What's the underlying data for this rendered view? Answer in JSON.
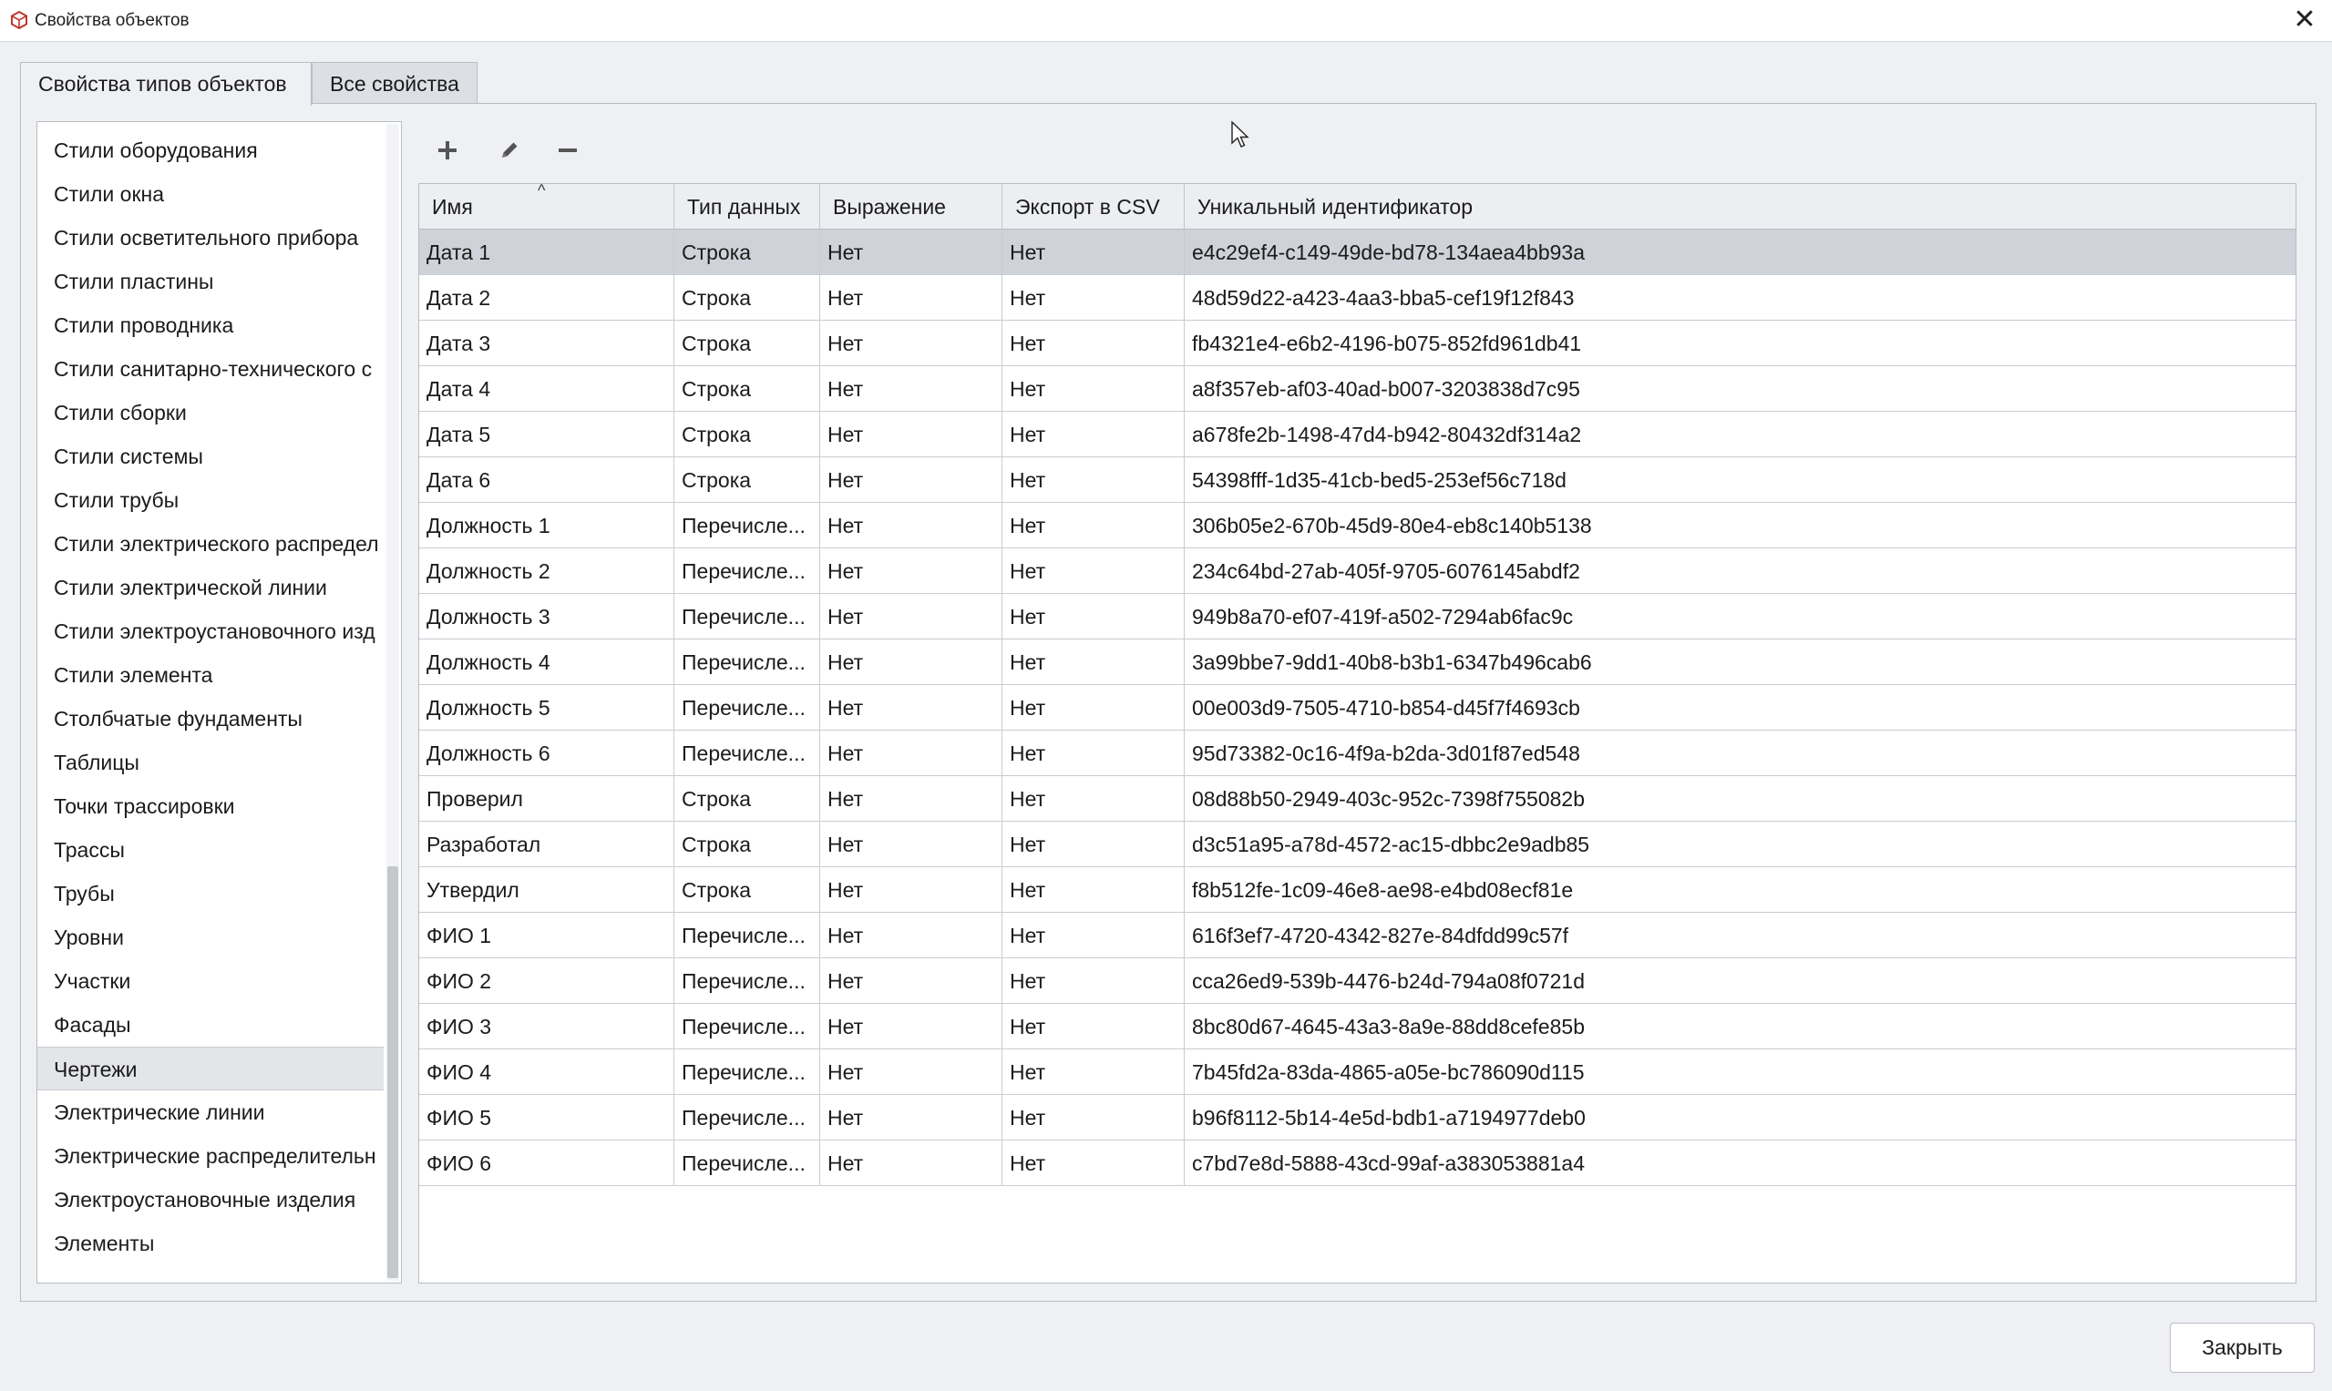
{
  "window": {
    "title": "Свойства объектов",
    "close_glyph": "✕"
  },
  "tabs": [
    {
      "label": "Свойства типов объектов",
      "active": true
    },
    {
      "label": "Все свойства",
      "active": false
    }
  ],
  "tree": {
    "selected_index": 21,
    "items": [
      "Стили оборудования",
      "Стили окна",
      "Стили осветительного прибора",
      "Стили пластины",
      "Стили проводника",
      "Стили санитарно-технического с",
      "Стили сборки",
      "Стили системы",
      "Стили трубы",
      "Стили электрического распредел",
      "Стили электрической линии",
      "Стили электроустановочного изд",
      "Стили элемента",
      "Столбчатые фундаменты",
      "Таблицы",
      "Точки трассировки",
      "Трассы",
      "Трубы",
      "Уровни",
      "Участки",
      "Фасады",
      "Чертежи",
      "Электрические линии",
      "Электрические распределительн",
      "Электроустановочные изделия",
      "Элементы"
    ]
  },
  "toolbar": {
    "add_icon": "plus-icon",
    "edit_icon": "pencil-icon",
    "remove_icon": "minus-icon"
  },
  "table": {
    "columns": [
      "Имя",
      "Тип данных",
      "Выражение",
      "Экспорт в CSV",
      "Уникальный идентификатор"
    ],
    "sort_indicator": "^",
    "selected_row": 0,
    "rows": [
      [
        "Дата 1",
        "Строка",
        "Нет",
        "Нет",
        "e4c29ef4-c149-49de-bd78-134aea4bb93a"
      ],
      [
        "Дата 2",
        "Строка",
        "Нет",
        "Нет",
        "48d59d22-a423-4aa3-bba5-cef19f12f843"
      ],
      [
        "Дата 3",
        "Строка",
        "Нет",
        "Нет",
        "fb4321e4-e6b2-4196-b075-852fd961db41"
      ],
      [
        "Дата 4",
        "Строка",
        "Нет",
        "Нет",
        "a8f357eb-af03-40ad-b007-3203838d7c95"
      ],
      [
        "Дата 5",
        "Строка",
        "Нет",
        "Нет",
        "a678fe2b-1498-47d4-b942-80432df314a2"
      ],
      [
        "Дата 6",
        "Строка",
        "Нет",
        "Нет",
        "54398fff-1d35-41cb-bed5-253ef56c718d"
      ],
      [
        "Должность 1",
        "Перечисле...",
        "Нет",
        "Нет",
        "306b05e2-670b-45d9-80e4-eb8c140b5138"
      ],
      [
        "Должность 2",
        "Перечисле...",
        "Нет",
        "Нет",
        "234c64bd-27ab-405f-9705-6076145abdf2"
      ],
      [
        "Должность 3",
        "Перечисле...",
        "Нет",
        "Нет",
        "949b8a70-ef07-419f-a502-7294ab6fac9c"
      ],
      [
        "Должность 4",
        "Перечисле...",
        "Нет",
        "Нет",
        "3a99bbe7-9dd1-40b8-b3b1-6347b496cab6"
      ],
      [
        "Должность 5",
        "Перечисле...",
        "Нет",
        "Нет",
        "00e003d9-7505-4710-b854-d45f7f4693cb"
      ],
      [
        "Должность 6",
        "Перечисле...",
        "Нет",
        "Нет",
        "95d73382-0c16-4f9a-b2da-3d01f87ed548"
      ],
      [
        "Проверил",
        "Строка",
        "Нет",
        "Нет",
        "08d88b50-2949-403c-952c-7398f755082b"
      ],
      [
        "Разработал",
        "Строка",
        "Нет",
        "Нет",
        "d3c51a95-a78d-4572-ac15-dbbc2e9adb85"
      ],
      [
        "Утвердил",
        "Строка",
        "Нет",
        "Нет",
        "f8b512fe-1c09-46e8-ae98-e4bd08ecf81e"
      ],
      [
        "ФИО 1",
        "Перечисле...",
        "Нет",
        "Нет",
        "616f3ef7-4720-4342-827e-84dfdd99c57f"
      ],
      [
        "ФИО 2",
        "Перечисле...",
        "Нет",
        "Нет",
        "cca26ed9-539b-4476-b24d-794a08f0721d"
      ],
      [
        "ФИО 3",
        "Перечисле...",
        "Нет",
        "Нет",
        "8bc80d67-4645-43a3-8a9e-88dd8cefe85b"
      ],
      [
        "ФИО 4",
        "Перечисле...",
        "Нет",
        "Нет",
        "7b45fd2a-83da-4865-a05e-bc786090d115"
      ],
      [
        "ФИО 5",
        "Перечисле...",
        "Нет",
        "Нет",
        "b96f8112-5b14-4e5d-bdb1-a7194977deb0"
      ],
      [
        "ФИО 6",
        "Перечисле...",
        "Нет",
        "Нет",
        "c7bd7e8d-5888-43cd-99af-a383053881a4"
      ]
    ]
  },
  "footer": {
    "close_label": "Закрыть"
  }
}
